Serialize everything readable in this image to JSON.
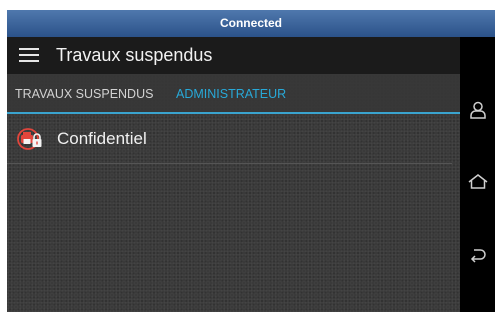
{
  "status_bar": {
    "text": "Connected",
    "color": "#3b6299"
  },
  "toolbar": {
    "menu_icon": "hamburger-menu-icon",
    "title": "Travaux suspendus"
  },
  "tabs": [
    {
      "label": "TRAVAUX SUSPENDUS",
      "active": false
    },
    {
      "label": "ADMINISTRATEUR",
      "active": true
    }
  ],
  "accent_color": "#28a9d8",
  "list": {
    "items": [
      {
        "label": "Confidentiel",
        "icon": "locked-print-job-icon"
      }
    ]
  },
  "nav_bar": {
    "buttons": [
      "user-icon",
      "home-icon",
      "back-icon"
    ]
  }
}
